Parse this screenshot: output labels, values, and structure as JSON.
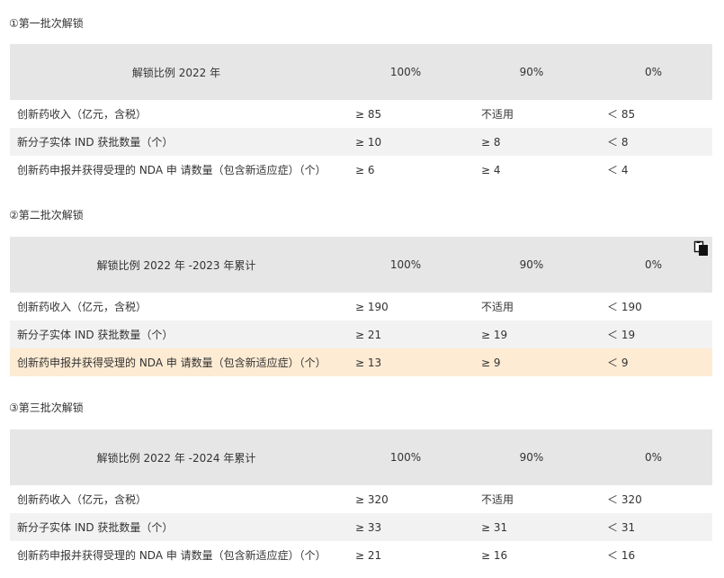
{
  "sections": [
    {
      "title": "①第一批次解锁",
      "header": [
        "解锁比例 2022 年",
        "100%",
        "90%",
        "0%"
      ],
      "rows": [
        [
          "创新药收入（亿元，含税）",
          "≥ 85",
          "不适用",
          "＜ 85"
        ],
        [
          "新分子实体 IND 获批数量（个）",
          "≥ 10",
          "≥ 8",
          "＜ 8"
        ],
        [
          "创新药申报并获得受理的 NDA 申 请数量（包含新适应症）（个）",
          "≥ 6",
          "≥ 4",
          "＜ 4"
        ]
      ]
    },
    {
      "title": "②第二批次解锁",
      "header": [
        "解锁比例 2022 年 -2023 年累计",
        "100%",
        "90%",
        "0%"
      ],
      "rows": [
        [
          "创新药收入（亿元，含税）",
          "≥ 190",
          "不适用",
          "＜ 190"
        ],
        [
          "新分子实体 IND 获批数量（个）",
          "≥ 21",
          "≥ 19",
          "＜ 19"
        ],
        [
          "创新药申报并获得受理的 NDA 申 请数量（包含新适应症）（个）",
          "≥ 13",
          "≥ 9",
          "＜ 9"
        ]
      ]
    },
    {
      "title": "③第三批次解锁",
      "header": [
        "解锁比例 2022 年 -2024 年累计",
        "100%",
        "90%",
        "0%"
      ],
      "rows": [
        [
          "创新药收入（亿元，含税）",
          "≥ 320",
          "不适用",
          "＜ 320"
        ],
        [
          "新分子实体 IND 获批数量（个）",
          "≥ 33",
          "≥ 31",
          "＜ 31"
        ],
        [
          "创新药申报并获得受理的 NDA 申 请数量（包含新适应症）（个）",
          "≥ 21",
          "≥ 16",
          "＜ 16"
        ]
      ]
    }
  ],
  "icons": {
    "copy": "copy-icon"
  },
  "colors": {
    "header_bg": "#e6e6e6",
    "stripe_bg": "#f2f2f2",
    "highlight_bg": "#fdebd3"
  }
}
